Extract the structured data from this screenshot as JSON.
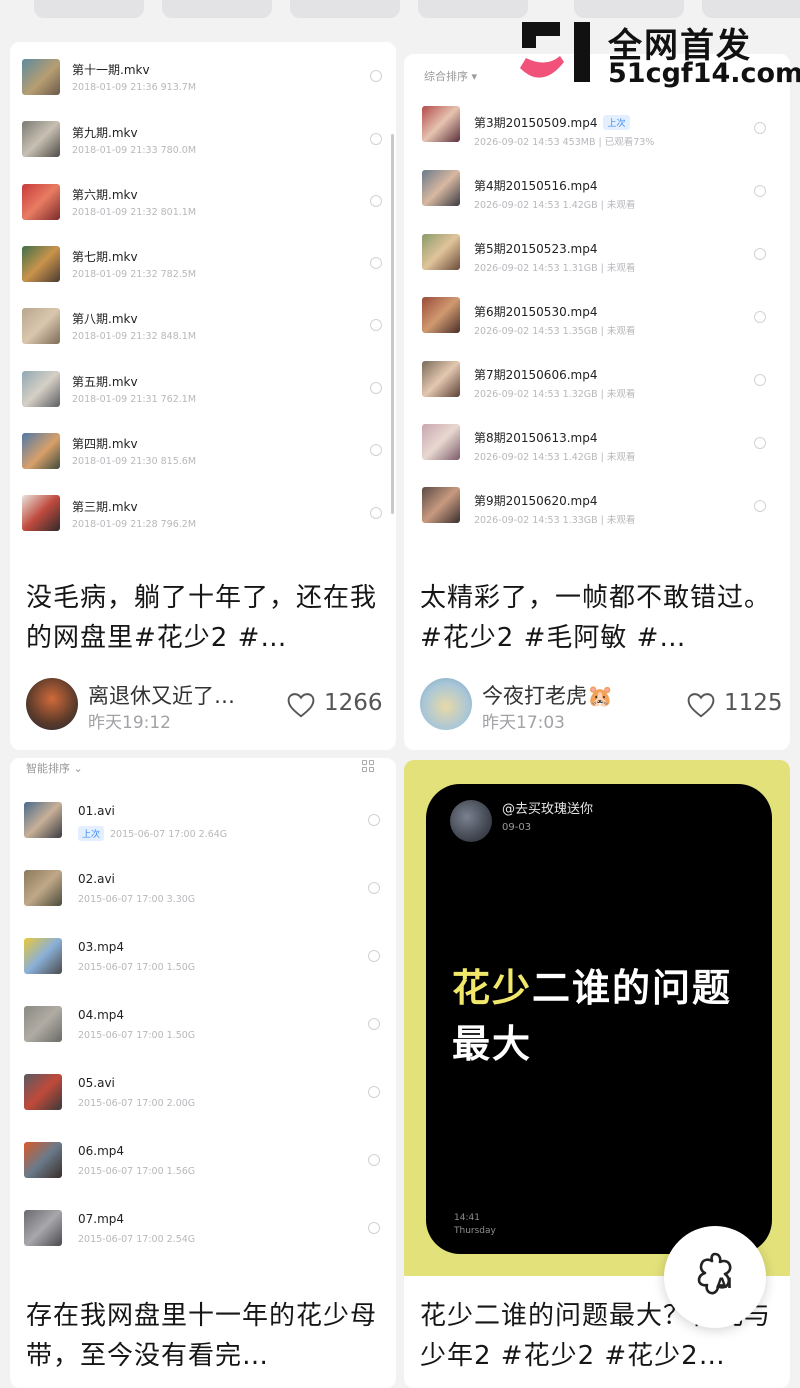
{
  "watermark": {
    "line1": "全网首发",
    "line2": "51cgf14.com"
  },
  "cards": [
    {
      "files": [
        {
          "name": "第十一期.mkv",
          "meta": "2018-01-09 21:36   913.7M"
        },
        {
          "name": "第九期.mkv",
          "meta": "2018-01-09 21:33   780.0M"
        },
        {
          "name": "第六期.mkv",
          "meta": "2018-01-09 21:32   801.1M"
        },
        {
          "name": "第七期.mkv",
          "meta": "2018-01-09 21:32   782.5M"
        },
        {
          "name": "第八期.mkv",
          "meta": "2018-01-09 21:32   848.1M"
        },
        {
          "name": "第五期.mkv",
          "meta": "2018-01-09 21:31   762.1M"
        },
        {
          "name": "第四期.mkv",
          "meta": "2018-01-09 21:30   815.6M"
        },
        {
          "name": "第三期.mkv",
          "meta": "2018-01-09 21:28   796.2M"
        }
      ],
      "caption": "没毛病，躺了十年了，还在我的网盘里#花少2 #…",
      "author": "离退休又近了…",
      "time": "昨天19:12",
      "likes": "1266"
    },
    {
      "sort_label": "综合排序 ▾",
      "files": [
        {
          "name": "第3期20150509.mp4",
          "tag": "上次",
          "meta": "2026-09-02 14:53  453MB | 已观看73%"
        },
        {
          "name": "第4期20150516.mp4",
          "meta": "2026-09-02 14:53  1.42GB | 未观看"
        },
        {
          "name": "第5期20150523.mp4",
          "meta": "2026-09-02 14:53  1.31GB | 未观看"
        },
        {
          "name": "第6期20150530.mp4",
          "meta": "2026-09-02 14:53  1.35GB | 未观看"
        },
        {
          "name": "第7期20150606.mp4",
          "meta": "2026-09-02 14:53  1.32GB | 未观看"
        },
        {
          "name": "第8期20150613.mp4",
          "meta": "2026-09-02 14:53  1.42GB | 未观看"
        },
        {
          "name": "第9期20150620.mp4",
          "meta": "2026-09-02 14:53  1.33GB | 未观看"
        }
      ],
      "caption": "太精彩了，一帧都不敢错过。#花少2 #毛阿敏 #…",
      "author": "今夜打老虎🐹",
      "time": "昨天17:03",
      "likes": "1125"
    },
    {
      "sort_label": "智能排序 ⌄",
      "files": [
        {
          "name": "01.avi",
          "tag": "上次",
          "meta": "2015-06-07 17:00   2.64G"
        },
        {
          "name": "02.avi",
          "meta": "2015-06-07 17:00   3.30G"
        },
        {
          "name": "03.mp4",
          "meta": "2015-06-07 17:00   1.50G"
        },
        {
          "name": "04.mp4",
          "meta": "2015-06-07 17:00   1.50G"
        },
        {
          "name": "05.avi",
          "meta": "2015-06-07 17:00   2.00G"
        },
        {
          "name": "06.mp4",
          "meta": "2015-06-07 17:00   1.56G"
        },
        {
          "name": "07.mp4",
          "meta": "2015-06-07 17:00   2.54G"
        }
      ],
      "caption": "存在我网盘里十一年的花少母带，至今没有看完…"
    },
    {
      "note_user": "@去买玫瑰送你",
      "note_date": "09-03",
      "note_highlight": "花少",
      "note_rest": "二谁的问题最大",
      "note_time": "14:41",
      "note_day": "Thursday",
      "caption": "花少二谁的问题最大？花儿与少年2 #花少2 #花少2…"
    }
  ],
  "ai_button_label": "AI",
  "colors": {
    "card4_bg": "#e3e27a",
    "highlight": "#f1e86b",
    "accent_blue": "#3c8cf0"
  }
}
